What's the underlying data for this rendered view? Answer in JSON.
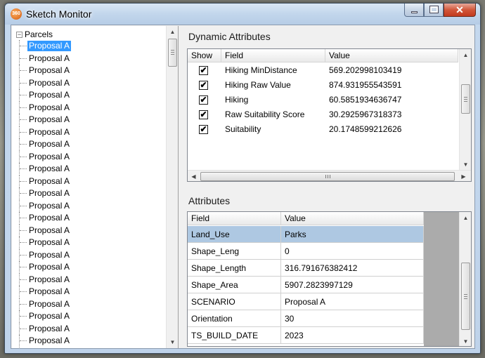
{
  "window": {
    "title": "Sketch Monitor",
    "icon_text": "360",
    "buttons": [
      "minimize",
      "maximize",
      "close"
    ]
  },
  "tree": {
    "root_label": "Parcels",
    "expander_glyph": "−",
    "items": [
      "Proposal A",
      "Proposal A",
      "Proposal A",
      "Proposal A",
      "Proposal A",
      "Proposal A",
      "Proposal A",
      "Proposal A",
      "Proposal A",
      "Proposal A",
      "Proposal A",
      "Proposal A",
      "Proposal A",
      "Proposal A",
      "Proposal A",
      "Proposal A",
      "Proposal A",
      "Proposal A",
      "Proposal A",
      "Proposal A",
      "Proposal A",
      "Proposal A",
      "Proposal A",
      "Proposal A",
      "Proposal A"
    ],
    "selected_index": 0
  },
  "dynamic": {
    "title": "Dynamic Attributes",
    "headers": {
      "show": "Show",
      "field": "Field",
      "value": "Value"
    },
    "rows": [
      {
        "show": true,
        "field": "Hiking MinDistance",
        "value": "569.202998103419"
      },
      {
        "show": true,
        "field": "Hiking Raw Value",
        "value": "874.931955543591"
      },
      {
        "show": true,
        "field": "Hiking",
        "value": "60.5851934636747"
      },
      {
        "show": true,
        "field": "Raw Suitability Score",
        "value": "30.2925967318373"
      },
      {
        "show": true,
        "field": "Suitability",
        "value": "20.1748599212626"
      }
    ],
    "check_glyph": "✔"
  },
  "attributes": {
    "title": "Attributes",
    "headers": {
      "field": "Field",
      "value": "Value"
    },
    "rows": [
      {
        "field": "Land_Use",
        "value": "Parks"
      },
      {
        "field": "Shape_Leng",
        "value": "0"
      },
      {
        "field": "Shape_Length",
        "value": "316.791676382412"
      },
      {
        "field": "Shape_Area",
        "value": "5907.2823997129"
      },
      {
        "field": "SCENARIO",
        "value": "Proposal A"
      },
      {
        "field": "Orientation",
        "value": "30"
      },
      {
        "field": "TS_BUILD_DATE",
        "value": "2023"
      }
    ],
    "selected_index": 0
  },
  "glyphs": {
    "up": "▲",
    "down": "▼",
    "left": "◀",
    "right": "▶",
    "hgrip": "III"
  },
  "colors": {
    "selection": "#3399ff",
    "grid_selection": "#aec8e2"
  }
}
